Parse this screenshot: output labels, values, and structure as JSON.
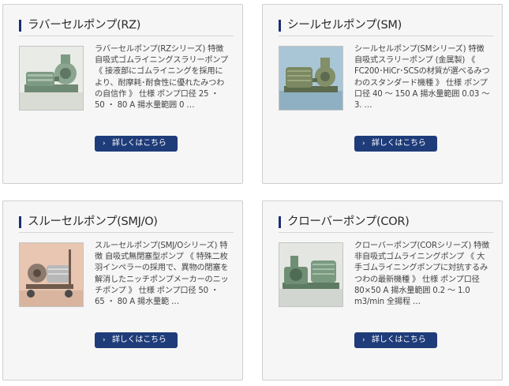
{
  "products": [
    {
      "title": "ラバーセルポンプ(RZ)",
      "image_alt": "pump-photo",
      "description": "ラバーセルポンプ(RZシリーズ) 特徴 自吸式ゴムライニングスラリーポンプ 《 接液部にゴムライニングを採用により、耐摩耗･耐食性に優れたみつわの自信作 》 仕様 ポンプ口径 25 ・ 50 ・ 80 A 揚水量範囲 0 …",
      "button_label": "詳しくはこちら",
      "button_icon": "chevron-right-icon"
    },
    {
      "title": "シールセルポンプ(SM)",
      "image_alt": "pump-photo",
      "description": "シールセルポンプ(SMシリーズ) 特徴 自吸式スラリーポンプ (金属製) 《 FC200･HiCr･SCSの材質が選べるみつわのスタンダード機種 》 仕様 ポンプ口径 40 ～ 150 A 揚水量範囲 0.03 ～ 3. …",
      "button_label": "詳しくはこちら",
      "button_icon": "chevron-right-icon"
    },
    {
      "title": "スルーセルポンプ(SMJ/O)",
      "image_alt": "pump-photo",
      "description": "スルーセルポンプ(SMJ/Oシリーズ) 特徴 自吸式無閉塞型ポンプ 《 特殊二枚羽インペラーの採用で、異物の閉塞を解消したニッチポンプメーカーのニッチポンプ 》 仕様 ポンプ口径 50 ・ 65 ・ 80 A 揚水量範 …",
      "button_label": "詳しくはこちら",
      "button_icon": "chevron-right-icon"
    },
    {
      "title": "クローバーポンプ(COR)",
      "image_alt": "pump-photo",
      "description": "クローバーポンプ(CORシリーズ) 特徴 非自吸式ゴムライニングポンプ 《 大手ゴムライニングポンプに対抗するみつわの最新機種 》 仕様 ポンプ口径 80×50 A 揚水量範囲 0.2 ～ 1.0 m3/min 全揚程 …",
      "button_label": "詳しくはこちら",
      "button_icon": "chevron-right-icon"
    }
  ],
  "colors": {
    "accent": "#1b2f73",
    "button": "#1f3c7a",
    "card_bg": "#f6f6f6",
    "card_border": "#cfcfcf",
    "text": "#444444"
  }
}
